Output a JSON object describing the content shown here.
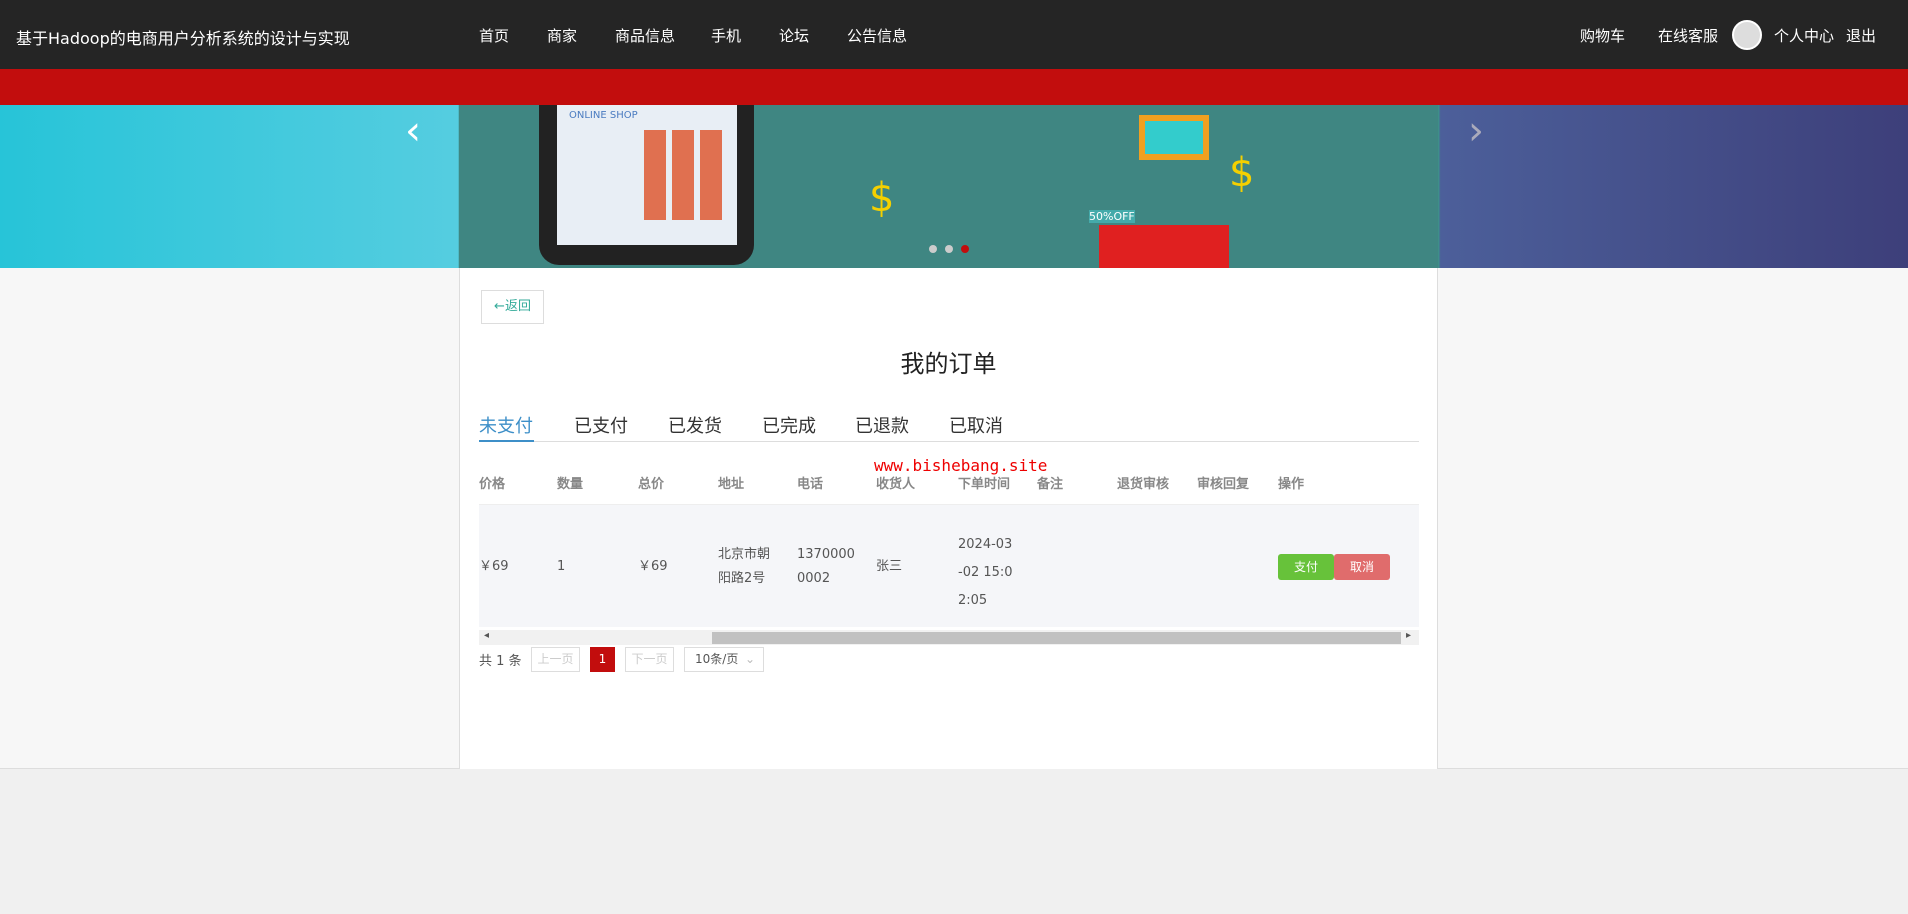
{
  "header": {
    "title": "基于Hadoop的电商用户分析系统的设计与实现",
    "nav": [
      "首页",
      "商家",
      "商品信息",
      "手机",
      "论坛",
      "公告信息"
    ],
    "right": [
      "购物车",
      "在线客服",
      "个人中心",
      "退出"
    ]
  },
  "banner": {
    "slides": 3,
    "active": 3,
    "prev_icon": "chevron-left-icon",
    "next_icon": "chevron-right-icon",
    "img_text": "ONLINE SHOP",
    "sale": "50%OFF"
  },
  "back_label": "←返回",
  "page_title": "我的订单",
  "tabs": [
    "未支付",
    "已支付",
    "已发货",
    "已完成",
    "已退款",
    "已取消"
  ],
  "active_tab": "未支付",
  "watermark": "www.bishebang.site",
  "table": {
    "headers": [
      "价格",
      "数量",
      "总价",
      "地址",
      "电话",
      "收货人",
      "下单时间",
      "备注",
      "退货审核",
      "审核回复",
      "操作"
    ],
    "rows": [
      {
        "price": "￥69",
        "qty": "1",
        "total": "￥69",
        "addr1": "北京市朝",
        "addr2": "阳路2号",
        "phone1": "1370000",
        "phone2": "0002",
        "receiver": "张三",
        "time1": "2024-03",
        "time2": "-02 15:0",
        "time3": "2:05",
        "pay": "支付",
        "cancel": "取消"
      }
    ]
  },
  "pagination": {
    "total": "共 1 条",
    "prev": "上一页",
    "page": "1",
    "next": "下一页",
    "size": "10条/页"
  },
  "colors": {
    "header": "#252525",
    "accent_red": "#c20d0d",
    "tab_active": "#3d8fc8",
    "pay": "#67c23a",
    "cancel": "#e06c6c"
  }
}
